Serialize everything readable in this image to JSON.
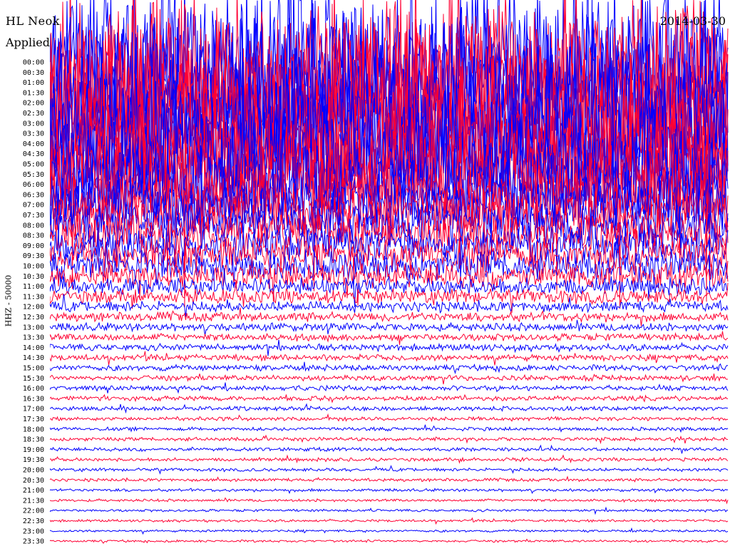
{
  "header": {
    "station": "HL Neok",
    "date": "2014-03-30",
    "filter": "Applied"
  },
  "chart_data": {
    "type": "line",
    "title": "",
    "xlabel": "",
    "ylabel": "HHZ - 50000",
    "row_labels": [
      "00:00",
      "00:30",
      "01:00",
      "01:30",
      "02:00",
      "02:30",
      "03:00",
      "03:30",
      "04:00",
      "04:30",
      "05:00",
      "05:30",
      "06:00",
      "06:30",
      "07:00",
      "07:30",
      "08:00",
      "08:30",
      "09:00",
      "09:30",
      "10:00",
      "10:30",
      "11:00",
      "11:30",
      "12:00",
      "12:30",
      "13:00",
      "13:30",
      "14:00",
      "14:30",
      "15:00",
      "15:30",
      "16:00",
      "16:30",
      "17:00",
      "17:30",
      "18:00",
      "18:30",
      "19:00",
      "19:30",
      "20:00",
      "20:30",
      "21:00",
      "21:30",
      "22:00",
      "22:30",
      "23:00",
      "23:30"
    ],
    "trace_colors": [
      "#0000ff",
      "#ff0033"
    ],
    "row_amplitude": [
      9,
      9,
      9,
      9,
      9,
      9,
      9,
      8.5,
      8,
      7.5,
      7,
      6,
      5,
      4,
      3.5,
      3,
      2.6,
      2.3,
      2.1,
      1.9,
      1.7,
      1.4,
      1.0,
      0.8,
      0.6,
      0.5,
      0.45,
      0.4,
      0.38,
      0.35,
      0.33,
      0.3,
      0.28,
      0.26,
      0.24,
      0.22,
      0.2,
      0.2,
      0.2,
      0.2,
      0.18,
      0.17,
      0.16,
      0.15,
      0.14,
      0.14,
      0.13,
      0.13
    ]
  }
}
